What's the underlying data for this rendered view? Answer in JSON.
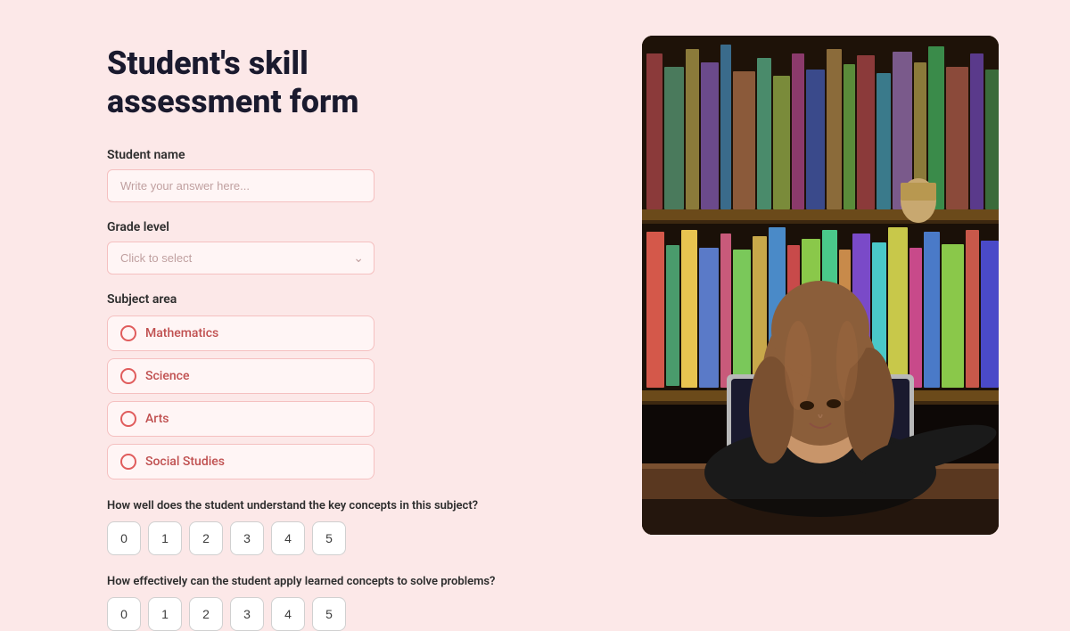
{
  "page": {
    "title_line1": "Student's skill",
    "title_line2": "assessment form"
  },
  "form": {
    "student_name": {
      "label": "Student name",
      "placeholder": "Write your answer here..."
    },
    "grade_level": {
      "label": "Grade level",
      "placeholder": "Click to select"
    },
    "subject_area": {
      "label": "Subject area",
      "options": [
        {
          "value": "mathematics",
          "text": "Mathematics"
        },
        {
          "value": "science",
          "text": "Science"
        },
        {
          "value": "arts",
          "text": "Arts"
        },
        {
          "value": "social_studies",
          "text": "Social Studies"
        }
      ]
    },
    "key_concepts": {
      "label": "How well does the student understand the key concepts in this subject?",
      "scale": [
        0,
        1,
        2,
        3,
        4,
        5
      ]
    },
    "apply_concepts": {
      "label": "How effectively can the student apply learned concepts to solve problems?",
      "scale": [
        0,
        1,
        2,
        3,
        4,
        5
      ]
    }
  },
  "colors": {
    "background": "#fce8e8",
    "input_bg": "#fff5f5",
    "input_border": "#f5c0c0",
    "radio_border": "#e05c5c",
    "radio_text": "#c05050",
    "title": "#1a1a2e",
    "label": "#2d2d2d",
    "scale_btn_border": "#d0d0d0"
  }
}
